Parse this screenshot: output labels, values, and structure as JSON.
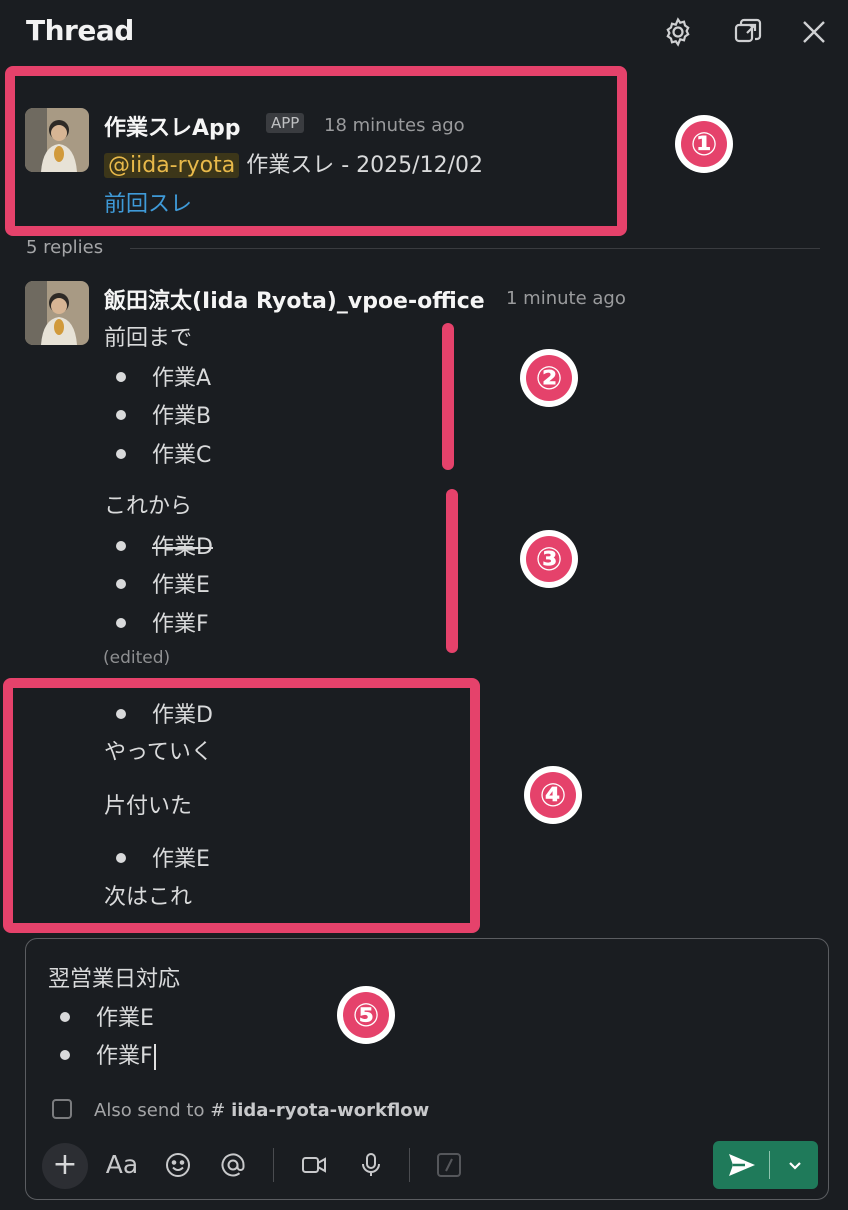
{
  "header": {
    "title": "Thread"
  },
  "parent": {
    "name": "作業スレApp",
    "badge": "APP",
    "time": "18 minutes ago",
    "mention": "@iida-ryota",
    "text": "作業スレ - 2025/12/02",
    "link": "前回スレ"
  },
  "replies_label": "5 replies",
  "reply": {
    "name": "飯田涼太(Iida Ryota)_vpoe-office",
    "time": "1 minute ago",
    "heading1": "前回まで",
    "list1": [
      "作業A",
      "作業B",
      "作業C"
    ],
    "heading2": "これから",
    "list2": [
      "作業D",
      "作業E",
      "作業F"
    ],
    "edited": "(edited)",
    "item_d": "作業D",
    "do_text": "やっていく",
    "done_text": "片付いた",
    "item_e": "作業E",
    "next_text": "次はこれ"
  },
  "composer": {
    "heading": "翌営業日対応",
    "items": [
      "作業E",
      "作業F"
    ],
    "also_send": "Also send to",
    "channel": "iida-ryota-workflow",
    "aa": "Aa"
  },
  "annotations": [
    "①",
    "②",
    "③",
    "④",
    "⑤"
  ],
  "colors": {
    "accent": "#e5426b",
    "send": "#1f7a5a",
    "link": "#3f9ad8",
    "mention": "#e8b94a"
  }
}
